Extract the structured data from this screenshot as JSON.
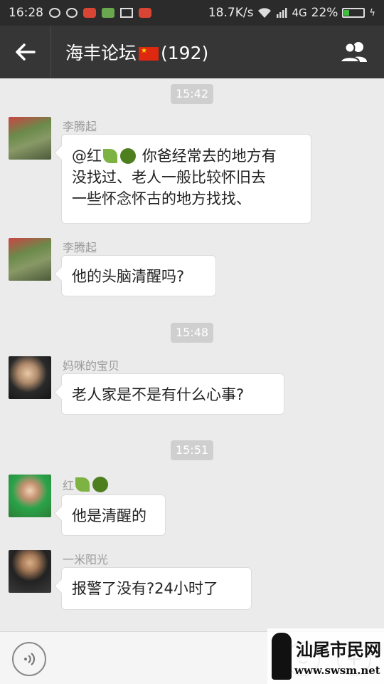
{
  "status_bar": {
    "time": "16:28",
    "net_speed": "18.7K/s",
    "network": "4G",
    "battery": "22%",
    "battery_level": 0.22
  },
  "header": {
    "back_icon": "arrow-left-icon",
    "title_prefix": "海丰论坛",
    "title_suffix": "(192)",
    "members_icon": "group-members-icon"
  },
  "chat": {
    "times": [
      "15:42",
      "15:48",
      "15:51"
    ],
    "messages": [
      {
        "sender": "李腾起",
        "lines": [
          "@红",
          "你爸经常去的地方有",
          "没找过、老人一般比较怀旧去",
          "一些怀念怀古的地方找找、"
        ]
      },
      {
        "sender": "李腾起",
        "text": "他的头脑清醒吗?"
      },
      {
        "sender": "妈咪的宝贝",
        "text": "老人家是不是有什么心事?"
      },
      {
        "sender": "红",
        "text": "他是清醒的"
      },
      {
        "sender": "一米阳光",
        "text": "报警了没有?24小时了"
      }
    ]
  },
  "input_bar": {
    "voice_icon": "voice-icon",
    "emoji_icon": "emoji-icon",
    "plus_icon": "plus-icon"
  },
  "watermark": {
    "text": "汕尾市民网",
    "url": "www.swsm.net"
  }
}
